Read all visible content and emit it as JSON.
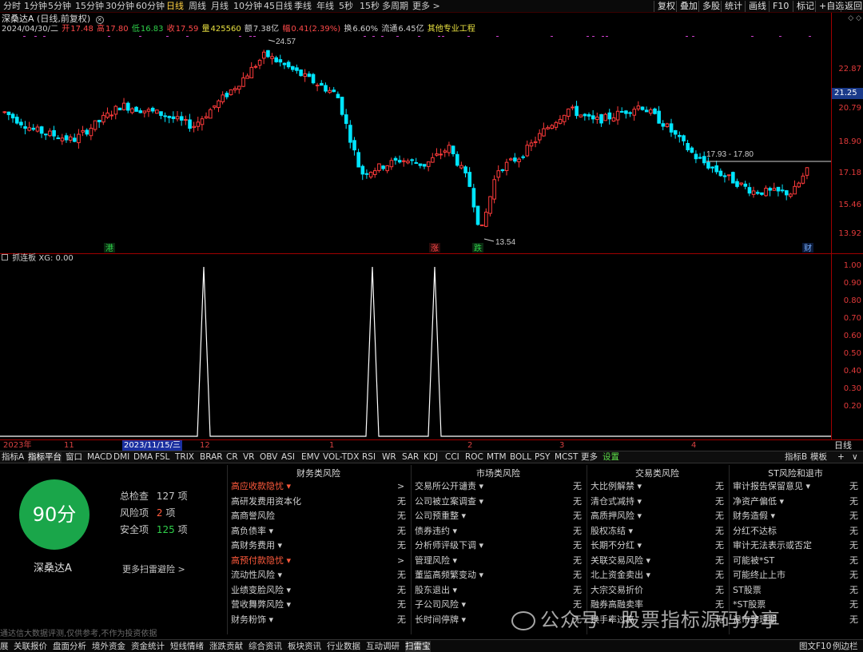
{
  "toolbar": {
    "left": [
      "分时",
      "1分钟",
      "5分钟",
      "15分钟",
      "30分钟",
      "60分钟",
      "日线",
      "周线",
      "月线",
      "10分钟",
      "45日线",
      "季线",
      "年线",
      "5秒",
      "15秒",
      "多周期",
      "更多 >"
    ],
    "right": [
      "复权",
      "叠加",
      "多股",
      "统计",
      "画线",
      "F10",
      "标记",
      "+自选",
      "返回"
    ]
  },
  "stock_header": {
    "name": "深桑达A",
    "mode": "(日线,前复权)",
    "close_icon": "circle-x-icon"
  },
  "quote": {
    "date": "2024/04/30/二",
    "open_label": "开",
    "open": "17.48",
    "high_label": "高",
    "high": "17.80",
    "low_label": "低",
    "low": "16.83",
    "close_label": "收",
    "close": "17.59",
    "vol_label": "量",
    "vol": "425560",
    "amount_label": "额",
    "amount": "7.38亿",
    "change_label": "幅",
    "change": "0.41(2.39%)",
    "turnover_label": "换",
    "turnover": "6.60%",
    "float_label": "流通",
    "float": "6.45亿",
    "industry": "其他专业工程"
  },
  "price_axis": {
    "labels": [
      "22.87",
      "20.79",
      "18.90",
      "17.18",
      "15.46",
      "13.92"
    ],
    "current": "21.25"
  },
  "annotations": {
    "high_mark": "24.57",
    "low_mark": "13.54",
    "range_label": "17.93 - 17.80",
    "markers": [
      {
        "text": "港",
        "color": "#2fd04a"
      },
      {
        "text": "涨",
        "color": "#ff4a4a"
      },
      {
        "text": "跌",
        "color": "#2fd04a"
      },
      {
        "text": "财",
        "color": "#7ab0ff"
      }
    ]
  },
  "indicator": {
    "name": "抓连板",
    "value_label": "XG: 0.00",
    "axis": [
      "1.00",
      "0.90",
      "0.80",
      "0.70",
      "0.60",
      "0.50",
      "0.40",
      "0.30",
      "0.20"
    ]
  },
  "date_axis": {
    "year": "2023年",
    "labels": [
      "11",
      "12",
      "1",
      "2",
      "3",
      "4"
    ],
    "selected": "2023/11/15/三",
    "cycle": "日线"
  },
  "indicator_tabs": [
    "指标A",
    "指标平台",
    "窗口",
    "MACD",
    "DMI",
    "DMA",
    "FSL",
    "TRIX",
    "BRAR",
    "CR",
    "VR",
    "OBV",
    "ASI",
    "EMV",
    "VOL-TDX",
    "RSI",
    "WR",
    "SAR",
    "KDJ",
    "CCI",
    "ROC",
    "MTM",
    "BOLL",
    "PSY",
    "MCST",
    "更多",
    "设置"
  ],
  "indicator_tabs_right": [
    "指标B",
    "模板",
    "+",
    "∨"
  ],
  "risk": {
    "score": "90分",
    "stock": "深桑达A",
    "total_label": "总检查",
    "total": "127",
    "total_unit": "项",
    "risk_label": "风险项",
    "risk_count": "2",
    "risk_unit": "项",
    "safe_label": "安全项",
    "safe_count": "125",
    "safe_unit": "项",
    "more": "更多扫雷避险 >",
    "disclaimer": "通达信大数据评测,仅供参考,不作为投资依据",
    "columns": [
      {
        "title": "财务类风险",
        "items": [
          {
            "name": "高应收款隐忧 ▾",
            "value": ">",
            "hi": true
          },
          {
            "name": "高研发费用资本化",
            "value": "无",
            "hi": false
          },
          {
            "name": "高商誉风险",
            "value": "无",
            "hi": false
          },
          {
            "name": "高负债率 ▾",
            "value": "无",
            "hi": false
          },
          {
            "name": "高财务费用 ▾",
            "value": "无",
            "hi": false
          },
          {
            "name": "高预付款隐忧 ▾",
            "value": ">",
            "hi": true
          },
          {
            "name": "流动性风险 ▾",
            "value": "无",
            "hi": false
          },
          {
            "name": "业绩变脸风险 ▾",
            "value": "无",
            "hi": false
          },
          {
            "name": "营收舞弊风险 ▾",
            "value": "无",
            "hi": false
          },
          {
            "name": "财务粉饰 ▾",
            "value": "无",
            "hi": false
          }
        ]
      },
      {
        "title": "市场类风险",
        "items": [
          {
            "name": "交易所公开谴责 ▾",
            "value": "无",
            "hi": false
          },
          {
            "name": "公司被立案调查 ▾",
            "value": "无",
            "hi": false
          },
          {
            "name": "公司预重整 ▾",
            "value": "无",
            "hi": false
          },
          {
            "name": "债券违约 ▾",
            "value": "无",
            "hi": false
          },
          {
            "name": "分析师评级下调 ▾",
            "value": "无",
            "hi": false
          },
          {
            "name": "管理风险 ▾",
            "value": "无",
            "hi": false
          },
          {
            "name": "董监高频繁变动 ▾",
            "value": "无",
            "hi": false
          },
          {
            "name": "股东退出 ▾",
            "value": "无",
            "hi": false
          },
          {
            "name": "子公司风险 ▾",
            "value": "无",
            "hi": false
          },
          {
            "name": "长时间停牌 ▾",
            "value": "无",
            "hi": false
          }
        ]
      },
      {
        "title": "交易类风险",
        "items": [
          {
            "name": "大比例解禁 ▾",
            "value": "无",
            "hi": false
          },
          {
            "name": "清仓式减持 ▾",
            "value": "无",
            "hi": false
          },
          {
            "name": "高质押风险 ▾",
            "value": "无",
            "hi": false
          },
          {
            "name": "股权冻结 ▾",
            "value": "无",
            "hi": false
          },
          {
            "name": "长期不分红 ▾",
            "value": "无",
            "hi": false
          },
          {
            "name": "关联交易风险 ▾",
            "value": "无",
            "hi": false
          },
          {
            "name": "北上资金卖出 ▾",
            "value": "无",
            "hi": false
          },
          {
            "name": "大宗交易折价",
            "value": "无",
            "hi": false
          },
          {
            "name": "融券高融卖率",
            "value": "无",
            "hi": false
          },
          {
            "name": "换手率过高",
            "value": "无",
            "hi": false
          }
        ]
      },
      {
        "title": "ST风险和退市",
        "items": [
          {
            "name": "审计报告保留意见 ▾",
            "value": "无",
            "hi": false
          },
          {
            "name": "净资产偏低 ▾",
            "value": "无",
            "hi": false
          },
          {
            "name": "财务造假 ▾",
            "value": "无",
            "hi": false
          },
          {
            "name": "分红不达标",
            "value": "无",
            "hi": false
          },
          {
            "name": "审计无法表示或否定",
            "value": "无",
            "hi": false
          },
          {
            "name": "可能被*ST",
            "value": "无",
            "hi": false
          },
          {
            "name": "可能终止上市",
            "value": "无",
            "hi": false
          },
          {
            "name": "ST股票",
            "value": "无",
            "hi": false
          },
          {
            "name": "*ST股票",
            "value": "无",
            "hi": false
          },
          {
            "name": "退市整理期",
            "value": "无",
            "hi": false
          }
        ]
      }
    ]
  },
  "watermark": "公众号 · 股票指标源码分享",
  "bottom_bar": [
    "展",
    "关联报价",
    "盘面分析",
    "境外资金",
    "资金统计",
    "短线情绪",
    "涨跌贡献",
    "综合资讯",
    "板块资讯",
    "行业数据",
    "互动调研",
    "扫雷宝"
  ],
  "bottom_right": [
    "图文F10",
    "例边栏"
  ],
  "colors": {
    "up": "#ff3b3b",
    "down": "#00e5ff",
    "axis": "#e23a3a",
    "score": "#1aa64a",
    "risk": "#ff5a3c"
  }
}
